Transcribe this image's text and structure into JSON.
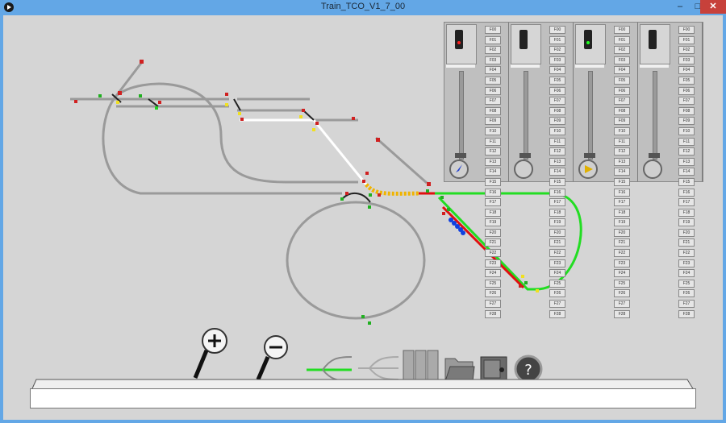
{
  "window": {
    "title": "Train_TCO_V1_7_00",
    "min_label": "–",
    "max_label": "□",
    "close_label": "✕"
  },
  "throttles": [
    {
      "lamp": "red",
      "direction": "reverse",
      "dir_color": "#2040d0",
      "fkeys_a": [
        "F00",
        "F01",
        "F02",
        "F03",
        "F04",
        "F05",
        "F06",
        "F07",
        "F08",
        "F09",
        "F10",
        "F11",
        "F12",
        "F13",
        "F14",
        "F15",
        "F16",
        "F17",
        "F18",
        "F19",
        "F20",
        "F21",
        "F22",
        "F23",
        "F24",
        "F25",
        "F26",
        "F27",
        "F28"
      ]
    },
    {
      "lamp": "none",
      "direction": "none",
      "dir_color": "#888888",
      "fkeys_a": [
        "F00",
        "F01",
        "F02",
        "F03",
        "F04",
        "F05",
        "F06",
        "F07",
        "F08",
        "F09",
        "F10",
        "F11",
        "F12",
        "F13",
        "F14",
        "F15",
        "F16",
        "F17",
        "F18",
        "F19",
        "F20",
        "F21",
        "F22",
        "F23",
        "F24",
        "F25",
        "F26",
        "F27",
        "F28"
      ]
    },
    {
      "lamp": "green",
      "direction": "forward",
      "dir_color": "#e0b000",
      "fkeys_a": [
        "F00",
        "F01",
        "F02",
        "F03",
        "F04",
        "F05",
        "F06",
        "F07",
        "F08",
        "F09",
        "F10",
        "F11",
        "F12",
        "F13",
        "F14",
        "F15",
        "F16",
        "F17",
        "F18",
        "F19",
        "F20",
        "F21",
        "F22",
        "F23",
        "F24",
        "F25",
        "F26",
        "F27",
        "F28"
      ]
    },
    {
      "lamp": "none",
      "direction": "none",
      "dir_color": "#888888",
      "fkeys_a": [
        "F00",
        "F01",
        "F02",
        "F03",
        "F04",
        "F05",
        "F06",
        "F07",
        "F08",
        "F09",
        "F10",
        "F11",
        "F12",
        "F13",
        "F14",
        "F15",
        "F16",
        "F17",
        "F18",
        "F19",
        "F20",
        "F21",
        "F22",
        "F23",
        "F24",
        "F25",
        "F26",
        "F27",
        "F28"
      ]
    }
  ],
  "toolbar": {
    "help_label": "?"
  },
  "status": {
    "value": ""
  },
  "colors": {
    "route_green": "#22dd22",
    "route_red": "#e01010",
    "occupied_yellow": "#f0b400",
    "train_blue": "#1040e0",
    "track_grey": "#9a9a9a"
  }
}
